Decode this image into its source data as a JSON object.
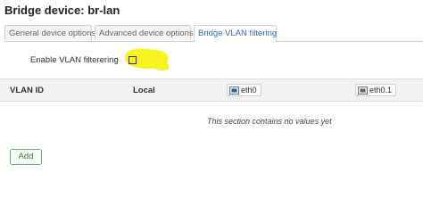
{
  "page": {
    "title": "Bridge device: br-lan"
  },
  "tabs": [
    {
      "label": "General device options",
      "active": false
    },
    {
      "label": "Advanced device options",
      "active": false
    },
    {
      "label": "Bridge VLAN filtering",
      "active": true
    }
  ],
  "vlan_filtering": {
    "label": "Enable VLAN filterering",
    "checked": false
  },
  "table": {
    "columns": {
      "vlan_id": "VLAN ID",
      "local": "Local",
      "ports": [
        "eth0",
        "eth0.1"
      ]
    },
    "empty_message": "This section contains no values yet"
  },
  "actions": {
    "add_label": "Add"
  },
  "colors": {
    "accent": "#2e6fb5",
    "add_button": "#2c7a2c",
    "highlight": "#f7f31d"
  }
}
